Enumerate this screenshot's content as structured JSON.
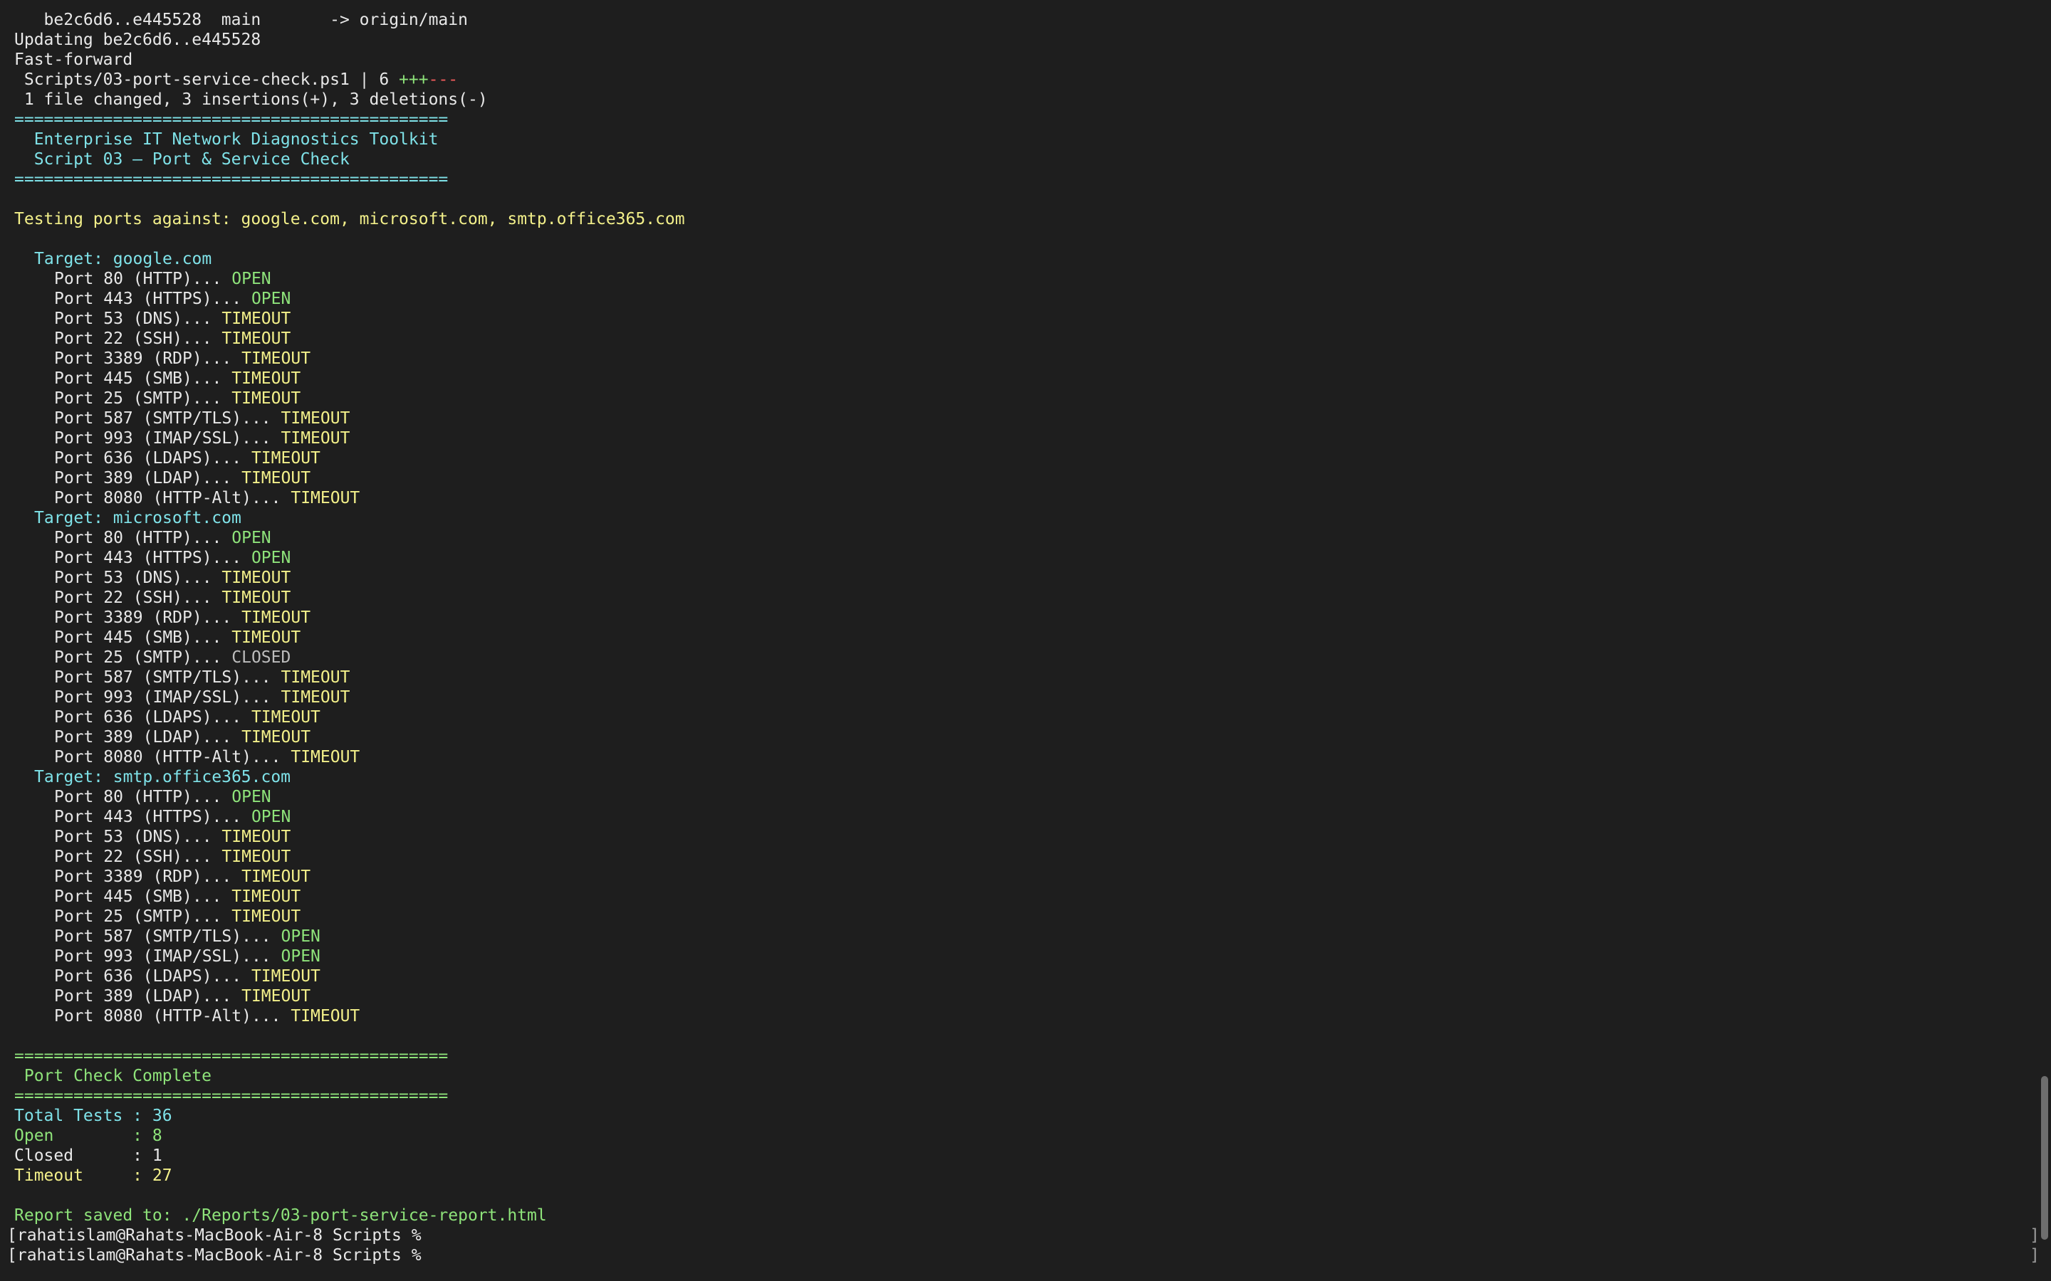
{
  "git": {
    "ref_line": "   be2c6d6..e445528  main       -> origin/main",
    "updating": "Updating be2c6d6..e445528",
    "fast_forward": "Fast-forward",
    "diffstat_file": " Scripts/03-port-service-check.ps1 | 6 ",
    "diffstat_plus": "+++",
    "diffstat_minus": "---",
    "summary": " 1 file changed, 3 insertions(+), 3 deletions(-)"
  },
  "banner": {
    "rule": "============================================",
    "title": "  Enterprise IT Network Diagnostics Toolkit",
    "subtitle": "  Script 03 — Port & Service Check"
  },
  "testing_line": "Testing ports against: google.com, microsoft.com, smtp.office365.com",
  "targets": [
    {
      "label": "Target: google.com",
      "ports": [
        {
          "text": "Port 80 (HTTP)... ",
          "status": "OPEN"
        },
        {
          "text": "Port 443 (HTTPS)... ",
          "status": "OPEN"
        },
        {
          "text": "Port 53 (DNS)... ",
          "status": "TIMEOUT"
        },
        {
          "text": "Port 22 (SSH)... ",
          "status": "TIMEOUT"
        },
        {
          "text": "Port 3389 (RDP)... ",
          "status": "TIMEOUT"
        },
        {
          "text": "Port 445 (SMB)... ",
          "status": "TIMEOUT"
        },
        {
          "text": "Port 25 (SMTP)... ",
          "status": "TIMEOUT"
        },
        {
          "text": "Port 587 (SMTP/TLS)... ",
          "status": "TIMEOUT"
        },
        {
          "text": "Port 993 (IMAP/SSL)... ",
          "status": "TIMEOUT"
        },
        {
          "text": "Port 636 (LDAPS)... ",
          "status": "TIMEOUT"
        },
        {
          "text": "Port 389 (LDAP)... ",
          "status": "TIMEOUT"
        },
        {
          "text": "Port 8080 (HTTP-Alt)... ",
          "status": "TIMEOUT"
        }
      ]
    },
    {
      "label": "Target: microsoft.com",
      "ports": [
        {
          "text": "Port 80 (HTTP)... ",
          "status": "OPEN"
        },
        {
          "text": "Port 443 (HTTPS)... ",
          "status": "OPEN"
        },
        {
          "text": "Port 53 (DNS)... ",
          "status": "TIMEOUT"
        },
        {
          "text": "Port 22 (SSH)... ",
          "status": "TIMEOUT"
        },
        {
          "text": "Port 3389 (RDP)... ",
          "status": "TIMEOUT"
        },
        {
          "text": "Port 445 (SMB)... ",
          "status": "TIMEOUT"
        },
        {
          "text": "Port 25 (SMTP)... ",
          "status": "CLOSED"
        },
        {
          "text": "Port 587 (SMTP/TLS)... ",
          "status": "TIMEOUT"
        },
        {
          "text": "Port 993 (IMAP/SSL)... ",
          "status": "TIMEOUT"
        },
        {
          "text": "Port 636 (LDAPS)... ",
          "status": "TIMEOUT"
        },
        {
          "text": "Port 389 (LDAP)... ",
          "status": "TIMEOUT"
        },
        {
          "text": "Port 8080 (HTTP-Alt)... ",
          "status": "TIMEOUT"
        }
      ]
    },
    {
      "label": "Target: smtp.office365.com",
      "ports": [
        {
          "text": "Port 80 (HTTP)... ",
          "status": "OPEN"
        },
        {
          "text": "Port 443 (HTTPS)... ",
          "status": "OPEN"
        },
        {
          "text": "Port 53 (DNS)... ",
          "status": "TIMEOUT"
        },
        {
          "text": "Port 22 (SSH)... ",
          "status": "TIMEOUT"
        },
        {
          "text": "Port 3389 (RDP)... ",
          "status": "TIMEOUT"
        },
        {
          "text": "Port 445 (SMB)... ",
          "status": "TIMEOUT"
        },
        {
          "text": "Port 25 (SMTP)... ",
          "status": "TIMEOUT"
        },
        {
          "text": "Port 587 (SMTP/TLS)... ",
          "status": "OPEN"
        },
        {
          "text": "Port 993 (IMAP/SSL)... ",
          "status": "OPEN"
        },
        {
          "text": "Port 636 (LDAPS)... ",
          "status": "TIMEOUT"
        },
        {
          "text": "Port 389 (LDAP)... ",
          "status": "TIMEOUT"
        },
        {
          "text": "Port 8080 (HTTP-Alt)... ",
          "status": "TIMEOUT"
        }
      ]
    }
  ],
  "complete": {
    "rule": "============================================",
    "title": " Port Check Complete"
  },
  "summary": {
    "total": "Total Tests : 36",
    "open": "Open        : 8",
    "closed": "Closed      : 1",
    "timeout": "Timeout     : 27"
  },
  "report_line": "Report saved to: ./Reports/03-port-service-report.html",
  "prompts": [
    "[rahatislam@Rahats-MacBook-Air-8 Scripts % ",
    "[rahatislam@Rahats-MacBook-Air-8 Scripts % "
  ],
  "prompt_right_bracket": "]",
  "colors": {
    "background": "#1e1e1e",
    "text": "#e8e8e8",
    "cyan": "#7fe2e8",
    "yellow": "#f3f08a",
    "green": "#8ee37a",
    "red": "#f05b5b",
    "closed_gray": "#bdbdbd"
  }
}
